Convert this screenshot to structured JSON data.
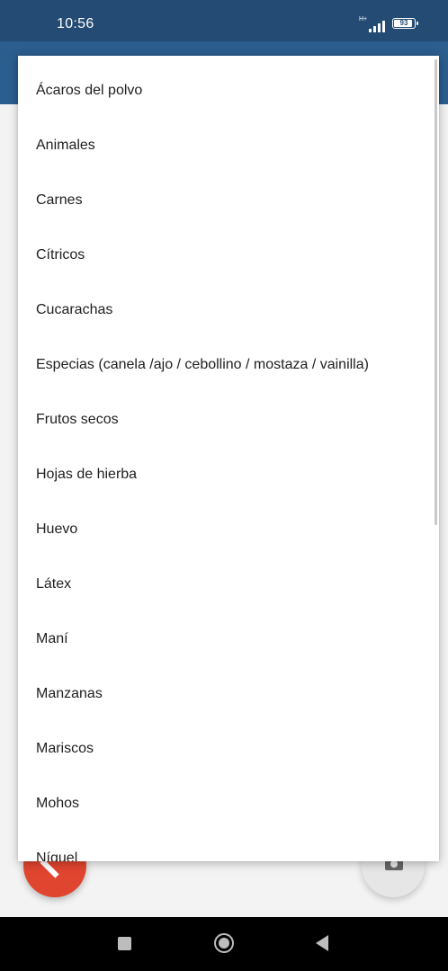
{
  "status_bar": {
    "time": "10:56",
    "network": "H+",
    "battery": "93",
    "battery_fraction": 0.93
  },
  "dropdown": {
    "items": [
      "Ácaros del polvo",
      "Animales",
      "Carnes",
      "Cítricos",
      "Cucarachas",
      "Especias (canela /ajo / cebollino / mostaza / vainilla)",
      "Frutos secos",
      "Hojas de hierba",
      "Huevo",
      "Látex",
      "Maní",
      "Manzanas",
      "Mariscos",
      "Mohos",
      "Níquel"
    ]
  },
  "colors": {
    "status_bar": "#244b73",
    "app_bar": "#2b5d8e",
    "fab_primary": "#e0452f",
    "fab_secondary": "#e6e6e6"
  },
  "icons": {
    "fab_left": "edit-icon",
    "fab_right": "camera-icon",
    "nav": [
      "square-recents-icon",
      "circle-home-icon",
      "triangle-back-icon"
    ]
  }
}
